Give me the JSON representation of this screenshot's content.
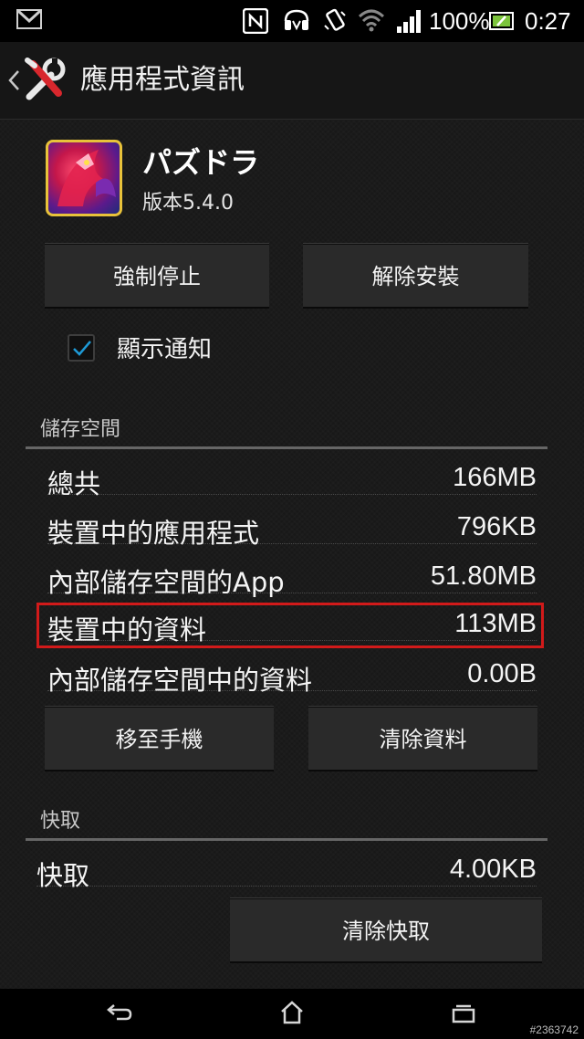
{
  "status_bar": {
    "battery_percent": "100%",
    "time": "0:27",
    "icons": [
      "gmail-icon",
      "nfc-icon",
      "headset-icon",
      "vibrate-icon",
      "wifi-icon",
      "signal-icon",
      "battery-icon"
    ]
  },
  "action_bar": {
    "title": "應用程式資訊",
    "icons": [
      "back-chevron-icon",
      "tools-icon"
    ]
  },
  "app": {
    "name": "パズドラ",
    "version": "版本5.4.0",
    "icon": "app-icon"
  },
  "buttons": {
    "force_stop": "強制停止",
    "uninstall": "解除安裝",
    "move_to_phone": "移至手機",
    "clear_data": "清除資料",
    "clear_cache": "清除快取"
  },
  "notifications": {
    "label": "顯示通知",
    "checked": true
  },
  "storage": {
    "section_title": "儲存空間",
    "rows": [
      {
        "label": "總共",
        "value": "166MB"
      },
      {
        "label": "裝置中的應用程式",
        "value": "796KB"
      },
      {
        "label": "內部儲存空間的App",
        "value": "51.80MB"
      },
      {
        "label": "裝置中的資料",
        "value": "113MB"
      },
      {
        "label": "內部儲存空間中的資料",
        "value": "0.00B"
      }
    ]
  },
  "cache": {
    "section_title": "快取",
    "label": "快取",
    "value": "4.00KB"
  },
  "nav_bar": {
    "icons": [
      "back-icon",
      "home-icon",
      "recent-apps-icon"
    ]
  },
  "watermark": "#2363742",
  "colors": {
    "background": "#181818",
    "highlight": "#d11a1a",
    "checkbox_accent": "#1e9ad6"
  }
}
